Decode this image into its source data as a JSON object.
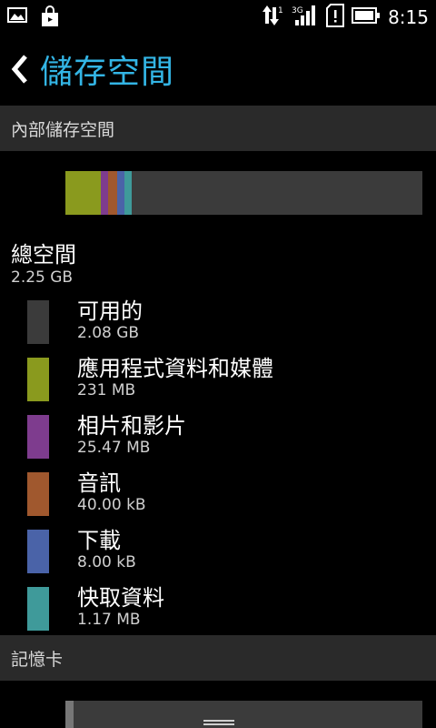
{
  "status_bar": {
    "time": "8:15",
    "network": "3G",
    "data_indicator": "1",
    "left_icons": [
      "gallery-icon",
      "shopping-bag-icon"
    ],
    "right_icons": [
      "data-transfer-icon",
      "signal-icon",
      "sim-alert-icon",
      "battery-icon"
    ]
  },
  "header": {
    "title": "儲存空間",
    "accent_color": "#33b5e5"
  },
  "internal": {
    "section_title": "內部儲存空間",
    "total_label": "總空間",
    "total_value": "2.25 GB",
    "usage_fractions": {
      "apps": 0.1,
      "photos": 0.02,
      "audio": 0.025,
      "downloads": 0.02,
      "cache": 0.02,
      "available": 0.815
    },
    "categories": [
      {
        "name": "可用的",
        "size": "2.08 GB",
        "color": "#3b3b3b"
      },
      {
        "name": "應用程式資料和媒體",
        "size": "231 MB",
        "color": "#8a9a1e"
      },
      {
        "name": "相片和影片",
        "size": "25.47 MB",
        "color": "#7e3c8e"
      },
      {
        "name": "音訊",
        "size": "40.00 kB",
        "color": "#a0582e"
      },
      {
        "name": "下載",
        "size": "8.00 kB",
        "color": "#4a63a8"
      },
      {
        "name": "快取資料",
        "size": "1.17 MB",
        "color": "#3f9a9a"
      }
    ]
  },
  "sd_card": {
    "section_title": "記憶卡"
  }
}
